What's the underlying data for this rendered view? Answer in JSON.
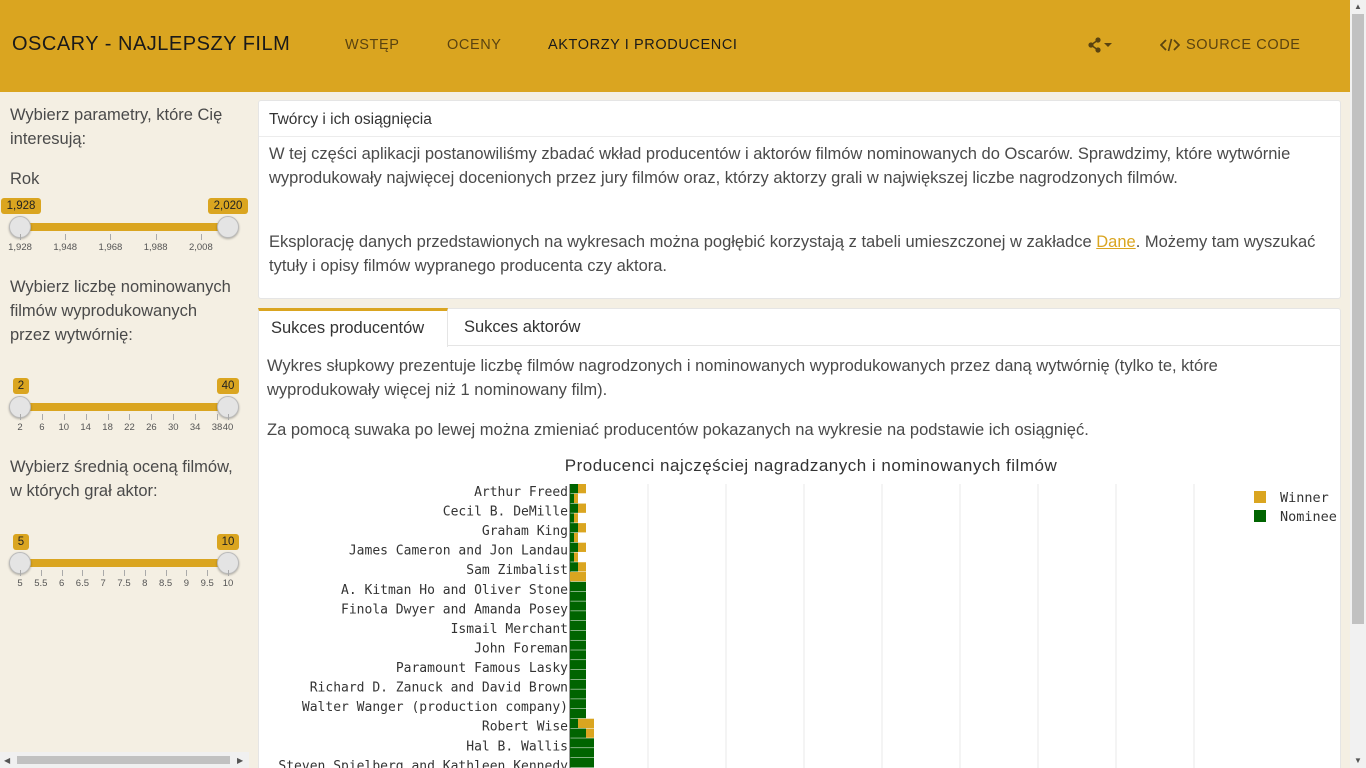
{
  "navbar": {
    "brand": "OSCARY - NAJLEPSZY FILM",
    "items": [
      "WSTĘP",
      "OCENY",
      "AKTORZY I PRODUCENCI"
    ],
    "source_label": "SOURCE CODE",
    "accent": "#daa520"
  },
  "sidebar": {
    "intro": "Wybierz parametry, które Cię interesują:",
    "year_label": "Rok",
    "year_slider": {
      "min": 1928,
      "max": 2020,
      "from": 1928,
      "to": 2020,
      "from_label": "1,928",
      "to_label": "2,020",
      "ticks": [
        "1,928",
        "1,948",
        "1,968",
        "1,988",
        "2,008"
      ]
    },
    "count_label": "Wybierz liczbę nominowanych filmów wyprodukowanych przez wytwórnię:",
    "count_slider": {
      "min": 2,
      "max": 40,
      "from": 2,
      "to": 40,
      "from_label": "2",
      "to_label": "40",
      "ticks": [
        "2",
        "6",
        "10",
        "14",
        "18",
        "22",
        "26",
        "30",
        "34",
        "38",
        "40"
      ]
    },
    "rating_label": "Wybierz średnią oceną filmów, w których grał aktor:",
    "rating_slider": {
      "min": 5,
      "max": 10,
      "from": 5,
      "to": 10,
      "from_label": "5",
      "to_label": "10",
      "ticks": [
        "5",
        "5.5",
        "6",
        "6.5",
        "7",
        "7.5",
        "8",
        "8.5",
        "9",
        "9.5",
        "10"
      ]
    }
  },
  "panel1": {
    "title": "Twórcy i ich osiągnięcia",
    "p1": "W tej części aplikacji postanowiliśmy zbadać wkład producentów i aktorów filmów nominowanych do Oscarów. Sprawdzimy, które wytwórnie wyprodukowały najwięcej docenionych przez jury filmów oraz, którzy aktorzy grali w największej liczbe nagrodzonych filmów.",
    "p2_before": "Eksplorację danych przedstawionych na wykresach można pogłębić korzystają z tabeli umieszczonej w zakładce ",
    "p2_link": "Dane",
    "p2_after": ". Możemy tam wyszukać tytuły i opisy filmów wypranego producenta czy aktora."
  },
  "tabs": [
    "Sukces producentów",
    "Sukces aktorów"
  ],
  "panel2": {
    "p1": "Wykres słupkowy prezentuje liczbę filmów nagrodzonych i nominowanych wyprodukowanych przez daną wytwórnię (tylko te, które wyprodukowały więcej niż 1 nominowany film).",
    "p2": "Za pomocą suwaka po lewej można zmieniać producentów pokazanych na wykresie na podstawie ich osiągnięć."
  },
  "chart_data": {
    "type": "bar",
    "orientation": "horizontal",
    "stacked": true,
    "title": "Producenci najczęściej nagradzanych i nominowanych filmów",
    "legend": [
      "Winner",
      "Nominee"
    ],
    "colors": {
      "Winner": "#daa520",
      "Nominee": "#006400"
    },
    "legend_position": "top-right",
    "grid": true,
    "labeled_categories": [
      "Arthur Freed",
      "Cecil B. DeMille",
      "Graham King",
      "James Cameron and Jon Landau",
      "Sam Zimbalist",
      "A. Kitman Ho and Oliver Stone",
      "Finola Dwyer and Amanda Posey",
      "Ismail Merchant",
      "John Foreman",
      "Paramount Famous Lasky",
      "Richard D. Zanuck and David Brown",
      "Walter Wanger (production company)",
      "Robert Wise",
      "Hal B. Wallis",
      "Steven Spielberg and Kathleen Kennedy"
    ],
    "rows": [
      {
        "label": "Arthur Freed",
        "winner": 2,
        "nominee": 2
      },
      {
        "label": "",
        "winner": 1,
        "nominee": 1
      },
      {
        "label": "Cecil B. DeMille",
        "winner": 2,
        "nominee": 2
      },
      {
        "label": "",
        "winner": 1,
        "nominee": 1
      },
      {
        "label": "Graham King",
        "winner": 2,
        "nominee": 2
      },
      {
        "label": "",
        "winner": 1,
        "nominee": 1
      },
      {
        "label": "James Cameron and Jon Landau",
        "winner": 2,
        "nominee": 2
      },
      {
        "label": "",
        "winner": 1,
        "nominee": 1
      },
      {
        "label": "Sam Zimbalist",
        "winner": 2,
        "nominee": 2
      },
      {
        "label": "",
        "winner": 4,
        "nominee": 0
      },
      {
        "label": "A. Kitman Ho and Oliver Stone",
        "winner": 0,
        "nominee": 4
      },
      {
        "label": "",
        "winner": 0,
        "nominee": 4
      },
      {
        "label": "Finola Dwyer and Amanda Posey",
        "winner": 0,
        "nominee": 4
      },
      {
        "label": "",
        "winner": 0,
        "nominee": 4
      },
      {
        "label": "Ismail Merchant",
        "winner": 0,
        "nominee": 4
      },
      {
        "label": "",
        "winner": 0,
        "nominee": 4
      },
      {
        "label": "John Foreman",
        "winner": 0,
        "nominee": 4
      },
      {
        "label": "",
        "winner": 0,
        "nominee": 4
      },
      {
        "label": "Paramount Famous Lasky",
        "winner": 0,
        "nominee": 4
      },
      {
        "label": "",
        "winner": 0,
        "nominee": 4
      },
      {
        "label": "Richard D. Zanuck and David Brown",
        "winner": 0,
        "nominee": 4
      },
      {
        "label": "",
        "winner": 0,
        "nominee": 4
      },
      {
        "label": "Walter Wanger (production company)",
        "winner": 0,
        "nominee": 4
      },
      {
        "label": "",
        "winner": 0,
        "nominee": 4
      },
      {
        "label": "Robert Wise",
        "winner": 4,
        "nominee": 2
      },
      {
        "label": "",
        "winner": 2,
        "nominee": 4
      },
      {
        "label": "Hal B. Wallis",
        "winner": 0,
        "nominee": 6
      },
      {
        "label": "",
        "winner": 0,
        "nominee": 6
      },
      {
        "label": "Steven Spielberg and Kathleen Kennedy",
        "winner": 0,
        "nominee": 6
      },
      {
        "label": "",
        "winner": 0,
        "nominee": 6
      }
    ],
    "xlim": [
      0,
      100
    ]
  }
}
